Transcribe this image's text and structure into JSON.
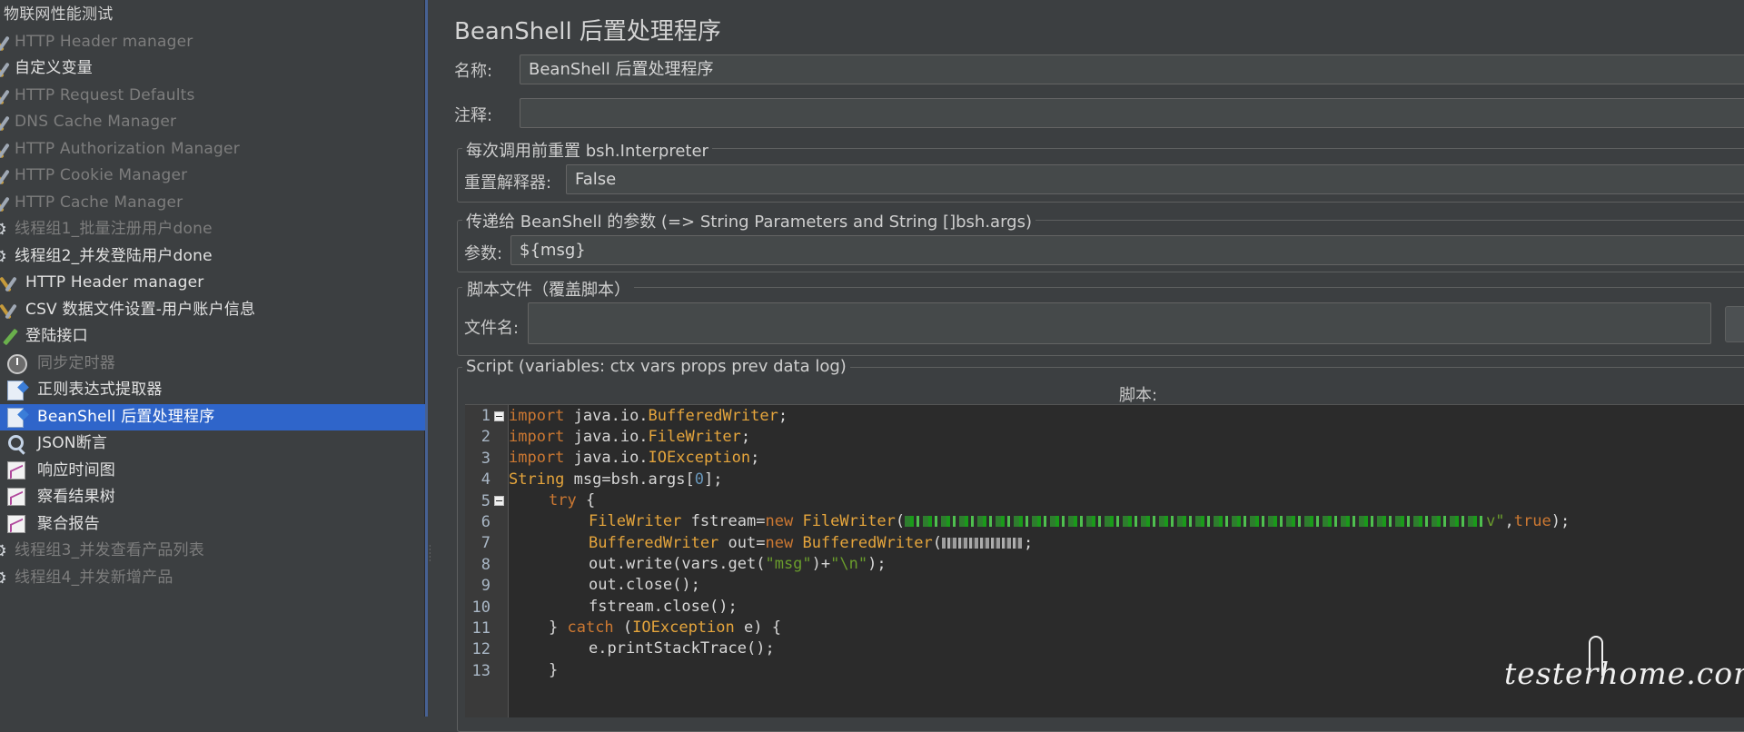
{
  "tree": {
    "items": [
      {
        "label": "物联网性能测试",
        "state": "root",
        "icon": "flask-icon",
        "indent": 0
      },
      {
        "label": "HTTP Header manager",
        "state": "disabled",
        "icon": "wrench-icon",
        "indent": 1
      },
      {
        "label": "自定义变量",
        "state": "enabled",
        "icon": "wrench-icon",
        "indent": 1
      },
      {
        "label": "HTTP Request Defaults",
        "state": "disabled",
        "icon": "wrench-icon",
        "indent": 1
      },
      {
        "label": "DNS Cache Manager",
        "state": "disabled",
        "icon": "wrench-icon",
        "indent": 1
      },
      {
        "label": "HTTP Authorization Manager",
        "state": "disabled",
        "icon": "wrench-icon",
        "indent": 1
      },
      {
        "label": "HTTP Cookie Manager",
        "state": "disabled",
        "icon": "wrench-icon",
        "indent": 1
      },
      {
        "label": "HTTP Cache Manager",
        "state": "disabled",
        "icon": "wrench-icon",
        "indent": 1
      },
      {
        "label": "线程组1_批量注册用户done",
        "state": "disabled",
        "icon": "gear-icon",
        "indent": 1
      },
      {
        "label": "线程组2_并发登陆用户done",
        "state": "enabled",
        "icon": "gear-icon",
        "indent": 1
      },
      {
        "label": "HTTP Header manager",
        "state": "enabled",
        "icon": "wrench-icon",
        "indent": 2
      },
      {
        "label": "CSV 数据文件设置-用户账户信息",
        "state": "enabled",
        "icon": "wrench-icon",
        "indent": 2
      },
      {
        "label": "登陆接口",
        "state": "enabled",
        "icon": "pen-icon",
        "indent": 2
      },
      {
        "label": "同步定时器",
        "state": "disabled",
        "icon": "clock-icon",
        "indent": 3
      },
      {
        "label": "正则表达式提取器",
        "state": "enabled",
        "icon": "document-icon",
        "indent": 3
      },
      {
        "label": "BeanShell 后置处理程序",
        "state": "selected",
        "icon": "document-icon",
        "indent": 3
      },
      {
        "label": "JSON断言",
        "state": "enabled",
        "icon": "magnifier-icon",
        "indent": 3
      },
      {
        "label": "响应时间图",
        "state": "enabled",
        "icon": "chart-icon",
        "indent": 3
      },
      {
        "label": "察看结果树",
        "state": "enabled",
        "icon": "chart-icon",
        "indent": 3
      },
      {
        "label": "聚合报告",
        "state": "enabled",
        "icon": "chart-icon",
        "indent": 3
      },
      {
        "label": "线程组3_并发查看产品列表",
        "state": "disabled",
        "icon": "gear-icon",
        "indent": 1
      },
      {
        "label": "线程组4_并发新增产品",
        "state": "disabled",
        "icon": "gear-icon",
        "indent": 1
      }
    ]
  },
  "panel": {
    "title": "BeanShell 后置处理程序",
    "name_label": "名称:",
    "name_value": "BeanShell 后置处理程序",
    "comment_label": "注释:",
    "comment_value": "",
    "reset_group_title": "每次调用前重置 bsh.Interpreter",
    "reset_label": "重置解释器:",
    "reset_value": "False",
    "params_group_title": "传递给 BeanShell 的参数 (=> String Parameters and String []bsh.args)",
    "params_label": "参数:",
    "params_value": "${msg}",
    "file_group_title": "脚本文件（覆盖脚本）",
    "file_label": "文件名:",
    "file_value": "",
    "script_group_title": "Script (variables: ctx vars props prev data log)",
    "script_header": "脚本:"
  },
  "script": {
    "line_numbers": [
      "1",
      "2",
      "3",
      "4",
      "5",
      "6",
      "7",
      "8",
      "9",
      "10",
      "11",
      "12",
      "13"
    ],
    "l1": {
      "kw": "import",
      "rest": " java.io.",
      "cls": "BufferedWriter",
      "end": ";"
    },
    "l2": {
      "kw": "import",
      "rest": " java.io.",
      "cls": "FileWriter",
      "end": ";"
    },
    "l3": {
      "kw": "import",
      "rest": " java.io.",
      "cls": "IOException",
      "end": ";"
    },
    "l4": {
      "cls": "String",
      "rest": " msg=bsh.args[",
      "num": "0",
      "end": "];"
    },
    "l5": {
      "kw": "try",
      "end": " {"
    },
    "l6": {
      "cls": "FileWriter",
      "a": " fstream=",
      "kw": "new",
      "b": " ",
      "cls2": "FileWriter",
      "c": "(",
      "str_end": "v\"",
      "d": ",",
      "kw2": "true",
      "e": ");"
    },
    "l7": {
      "cls": "BufferedWriter",
      "a": " out=",
      "kw": "new",
      "b": " ",
      "cls2": "BufferedWriter",
      "c": "(",
      "e": ";"
    },
    "l8": {
      "a": "out.write(vars.get(",
      "str": "\"msg\"",
      "b": ")+",
      "str2": "\"\\n\"",
      "c": ");"
    },
    "l9": {
      "a": "out.close();"
    },
    "l10": {
      "a": "fstream.close();"
    },
    "l11": {
      "a": "} ",
      "kw": "catch",
      "b": " (",
      "cls": "IOException",
      "c": " e) {"
    },
    "l12": {
      "a": "e.printStackTrace();"
    },
    "l13": {
      "a": "}"
    }
  },
  "watermark": "testerhome.com"
}
